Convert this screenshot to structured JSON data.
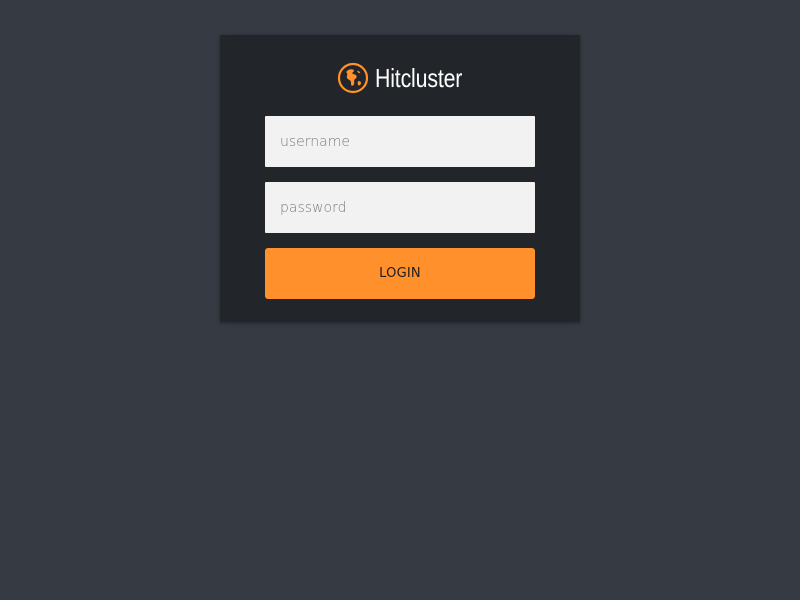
{
  "brand": {
    "name": "Hitcluster",
    "logo_icon": "globe-americas-icon",
    "accent_color": "#ff902b"
  },
  "form": {
    "username": {
      "value": "",
      "placeholder": "username"
    },
    "password": {
      "value": "",
      "placeholder": "password"
    },
    "login_label": "LOGIN"
  },
  "colors": {
    "page_background": "#363a42",
    "card_background": "#22252a",
    "input_background": "#f2f2f2",
    "button_background": "#ff902b"
  }
}
